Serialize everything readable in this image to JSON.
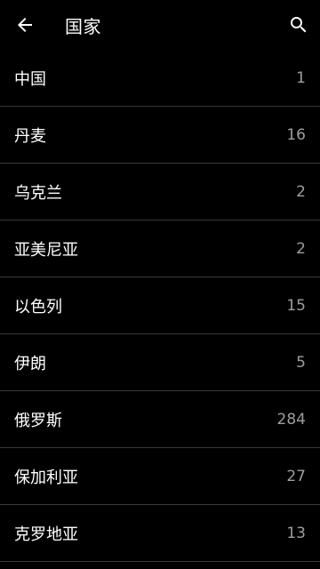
{
  "header": {
    "title": "国家",
    "back_icon": "arrow-back-icon",
    "search_icon": "search-icon"
  },
  "colors": {
    "background": "#000000",
    "text": "#ffffff",
    "count": "#9e9e9e",
    "divider": "#3a3a3a"
  },
  "countries": [
    {
      "name": "中国",
      "count": "1"
    },
    {
      "name": "丹麦",
      "count": "16"
    },
    {
      "name": "乌克兰",
      "count": "2"
    },
    {
      "name": "亚美尼亚",
      "count": "2"
    },
    {
      "name": "以色列",
      "count": "15"
    },
    {
      "name": "伊朗",
      "count": "5"
    },
    {
      "name": "俄罗斯",
      "count": "284"
    },
    {
      "name": "保加利亚",
      "count": "27"
    },
    {
      "name": "克罗地亚",
      "count": "13"
    }
  ]
}
